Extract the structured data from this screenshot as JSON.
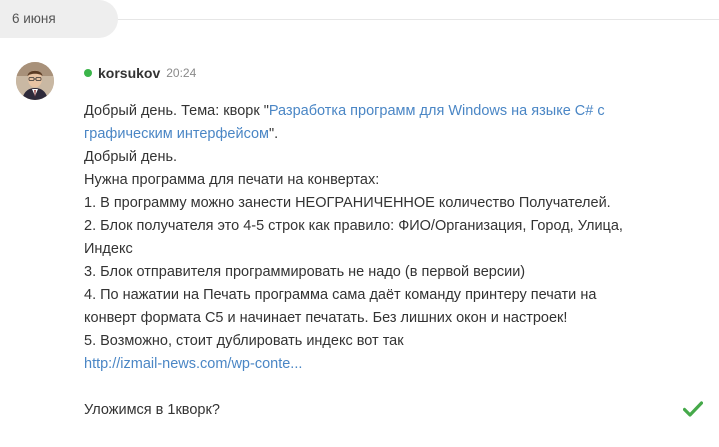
{
  "date_divider": {
    "label": "6 июня"
  },
  "message": {
    "author": "korsukov",
    "time": "20:24",
    "online": true,
    "text": {
      "line1_before": "Добрый день. Тема: кворк \"",
      "topic_line1": "Разработка программ для Windows на языке C# с",
      "topic_line2": "графическим интерфейсом",
      "line2_after": "\".",
      "greeting": "Добрый день.",
      "intro": "Нужна программа для печати на конвертах:",
      "item1": "1. В программу можно занести НЕОГРАНИЧЕННОЕ количество Получателей.",
      "item2_line1": "2. Блок получателя это 4-5 строк как правило: ФИО/Организация, Город, Улица,",
      "item2_line2": "Индекс",
      "item3": "3. Блок отправителя программировать не надо (в первой версии)",
      "item4_line1": "4. По нажатии на Печать программа сама даёт команду принтеру печати на",
      "item4_line2": "конверт формата С5 и начинает печатать. Без лишних окон и настроек!",
      "item5": "5. Возможно, стоит дублировать индекс вот так",
      "link": "http://izmail-news.com/wp-conte...",
      "question": "Уложимся в 1кворк?"
    },
    "read_status_icon": "check-icon",
    "colors": {
      "link": "#4a86c5",
      "online": "#3bb54a",
      "check": "#45a94a"
    }
  }
}
